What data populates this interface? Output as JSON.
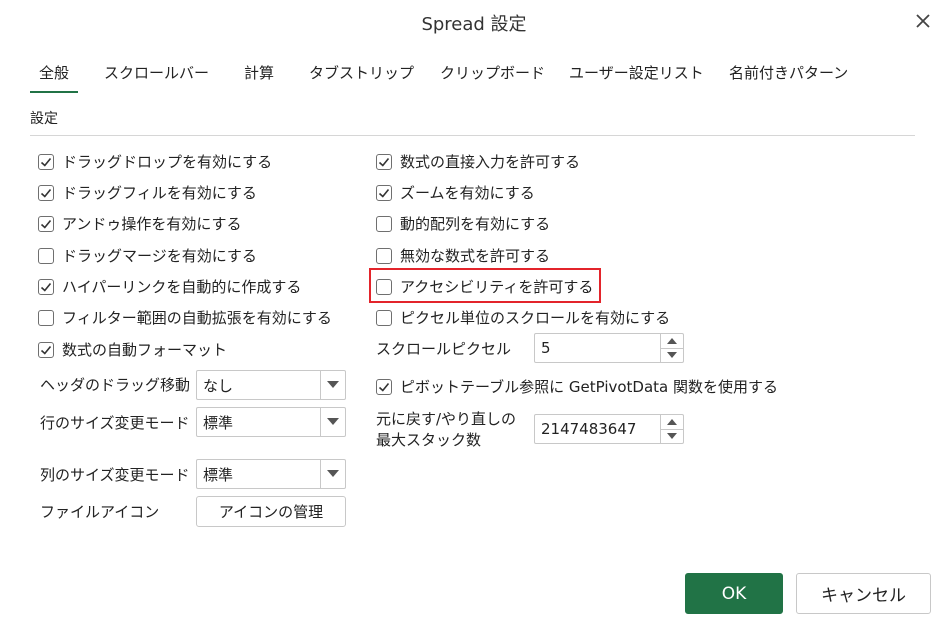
{
  "dialog": {
    "title": "Spread 設定"
  },
  "tabs": [
    "全般",
    "スクロールバー",
    "計算",
    "タブストリップ",
    "クリップボード",
    "ユーザー設定リスト",
    "名前付きパターン"
  ],
  "section_label": "設定",
  "left_checkboxes": [
    {
      "label": "ドラッグドロップを有効にする",
      "checked": true
    },
    {
      "label": "ドラッグフィルを有効にする",
      "checked": true
    },
    {
      "label": "アンドゥ操作を有効にする",
      "checked": true
    },
    {
      "label": "ドラッグマージを有効にする",
      "checked": false
    },
    {
      "label": "ハイパーリンクを自動的に作成する",
      "checked": true
    },
    {
      "label": "フィルター範囲の自動拡張を有効にする",
      "checked": false
    },
    {
      "label": "数式の自動フォーマット",
      "checked": true
    }
  ],
  "right_checkboxes": [
    {
      "label": "数式の直接入力を許可する",
      "checked": true
    },
    {
      "label": "ズームを有効にする",
      "checked": true
    },
    {
      "label": "動的配列を有効にする",
      "checked": false
    },
    {
      "label": "無効な数式を許可する",
      "checked": false
    },
    {
      "label": "アクセシビリティを許可する",
      "checked": false
    },
    {
      "label": "ピクセル単位のスクロールを有効にする",
      "checked": false
    }
  ],
  "header_drag": {
    "label": "ヘッダのドラッグ移動",
    "value": "なし"
  },
  "row_resize": {
    "label": "行のサイズ変更モード",
    "value": "標準"
  },
  "col_resize": {
    "label": "列のサイズ変更モード",
    "value": "標準"
  },
  "file_icon": {
    "label": "ファイルアイコン",
    "button": "アイコンの管理"
  },
  "scroll_pixel": {
    "label": "スクロールピクセル",
    "value": "5"
  },
  "pivot": {
    "label": "ピボットテーブル参照に GetPivotData 関数を使用する",
    "checked": true
  },
  "undo_stack": {
    "label_line1": "元に戻す/やり直しの",
    "label_line2": "最大スタック数",
    "value": "2147483647"
  },
  "buttons": {
    "ok": "OK",
    "cancel": "キャンセル"
  },
  "colors": {
    "accent": "#217346",
    "highlight": "#e3242b"
  },
  "icons": {
    "close": "close-icon",
    "dropdown": "chevron-down-icon",
    "check": "checkmark-icon"
  }
}
